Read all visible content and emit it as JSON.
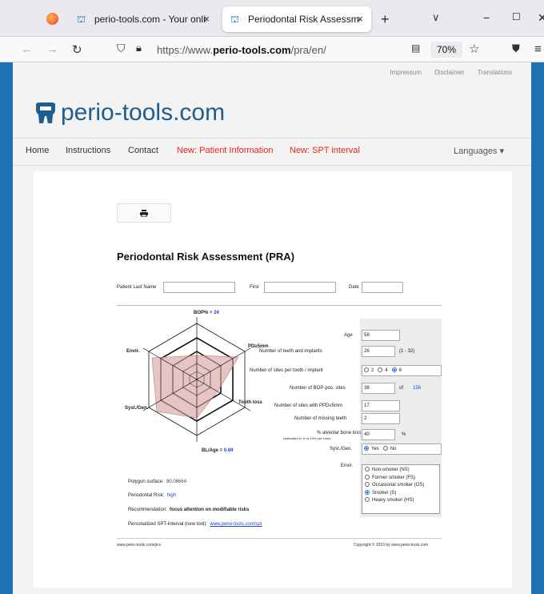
{
  "browser": {
    "tabs": [
      {
        "title": "perio-tools.com - Your online pe",
        "close": "×"
      },
      {
        "title": "Periodontal Risk Assessment (PR",
        "close": "×"
      }
    ],
    "new_tab": "+",
    "list_all": "∨",
    "minimize": "−",
    "maximize": "☐",
    "close": "✕",
    "url_prefix": "https://www.",
    "url_domain": "perio-tools.com",
    "url_path": "/pra/en/",
    "zoom": "70%"
  },
  "site": {
    "topnav": [
      "Impressum",
      "Disclaimer",
      "Translations"
    ],
    "logo_text": "perio-tools.com",
    "menu": {
      "home": "Home",
      "instructions": "Instructions",
      "contact": "Contact",
      "patient_info": "New: Patient Information",
      "spt_interval": "New: SPT interval",
      "languages": "Languages ▾"
    }
  },
  "form": {
    "print_icon": "print-icon",
    "title": "Periodontal Risk Assessment (PRA)",
    "patient_last_name_label": "Patient Last Name",
    "first_label": "First",
    "date_label": "Date",
    "age_label": "Age",
    "age": "58",
    "teeth_label": "Number of teeth and implants",
    "teeth": "26",
    "teeth_range": "(1 - 32)",
    "sites_label": "Number of sites per tooth / implant",
    "sites_options": [
      "2",
      "4",
      "6"
    ],
    "sites_selected": "6",
    "bop_sites_label": "Number of BOP-pos. sites",
    "bop_sites": "38",
    "bop_of": "of",
    "bop_total": "156",
    "ppd_label": "Number of sites with PPD≥5mm",
    "ppd": "17",
    "missing_label": "Number of missing teeth",
    "missing": "2",
    "bone_loss_label": "% alveolar bone loss",
    "bone_loss_sub": "(estimated in % or 10% per 1mm)",
    "bone_loss": "40",
    "bone_loss_unit": "%",
    "syst_label": "Syst./Gen.",
    "syst_yes": "Yes",
    "syst_no": "No",
    "envir_label": "Envir.",
    "smoker_options": [
      "Non-smoker (NS)",
      "Former smoker (FS)",
      "Occasional smoker (OS)",
      "Smoker (S)",
      "Heavy smoker (HS)"
    ],
    "smoker_selected": "Smoker (S)"
  },
  "radar": {
    "bop_label": "BOP% = ",
    "bop_value": "24",
    "pd_label": "PD≥5mm",
    "tooth_loss_label": "Tooth loss",
    "bl_age_label": "BL/Age = ",
    "bl_age_value": "0.69",
    "syst_label": "Syst./Gen.",
    "envir_label": "Envir."
  },
  "results": {
    "polygon_label": "Polygon surface:",
    "polygon_value": "90.06664",
    "risk_label": "Periodontal Risk:",
    "risk_value": "high",
    "recommendation_label": "Recommendation:",
    "recommendation_value": "focus attention on modifiable risks",
    "spt_label": "Personalized SPT-Interval (new tool):",
    "spt_link": "www.perio-tools.com/spt"
  },
  "footer": {
    "left": "www.perio-tools.com/pra",
    "right": "Copyright © 2010 by www.perio-tools.com"
  },
  "colors": {
    "accent_red": "#e8261c",
    "logo_blue": "#1f5d8e",
    "value_blue": "#2244cc",
    "polygon_fill": "#d9a6a6"
  }
}
